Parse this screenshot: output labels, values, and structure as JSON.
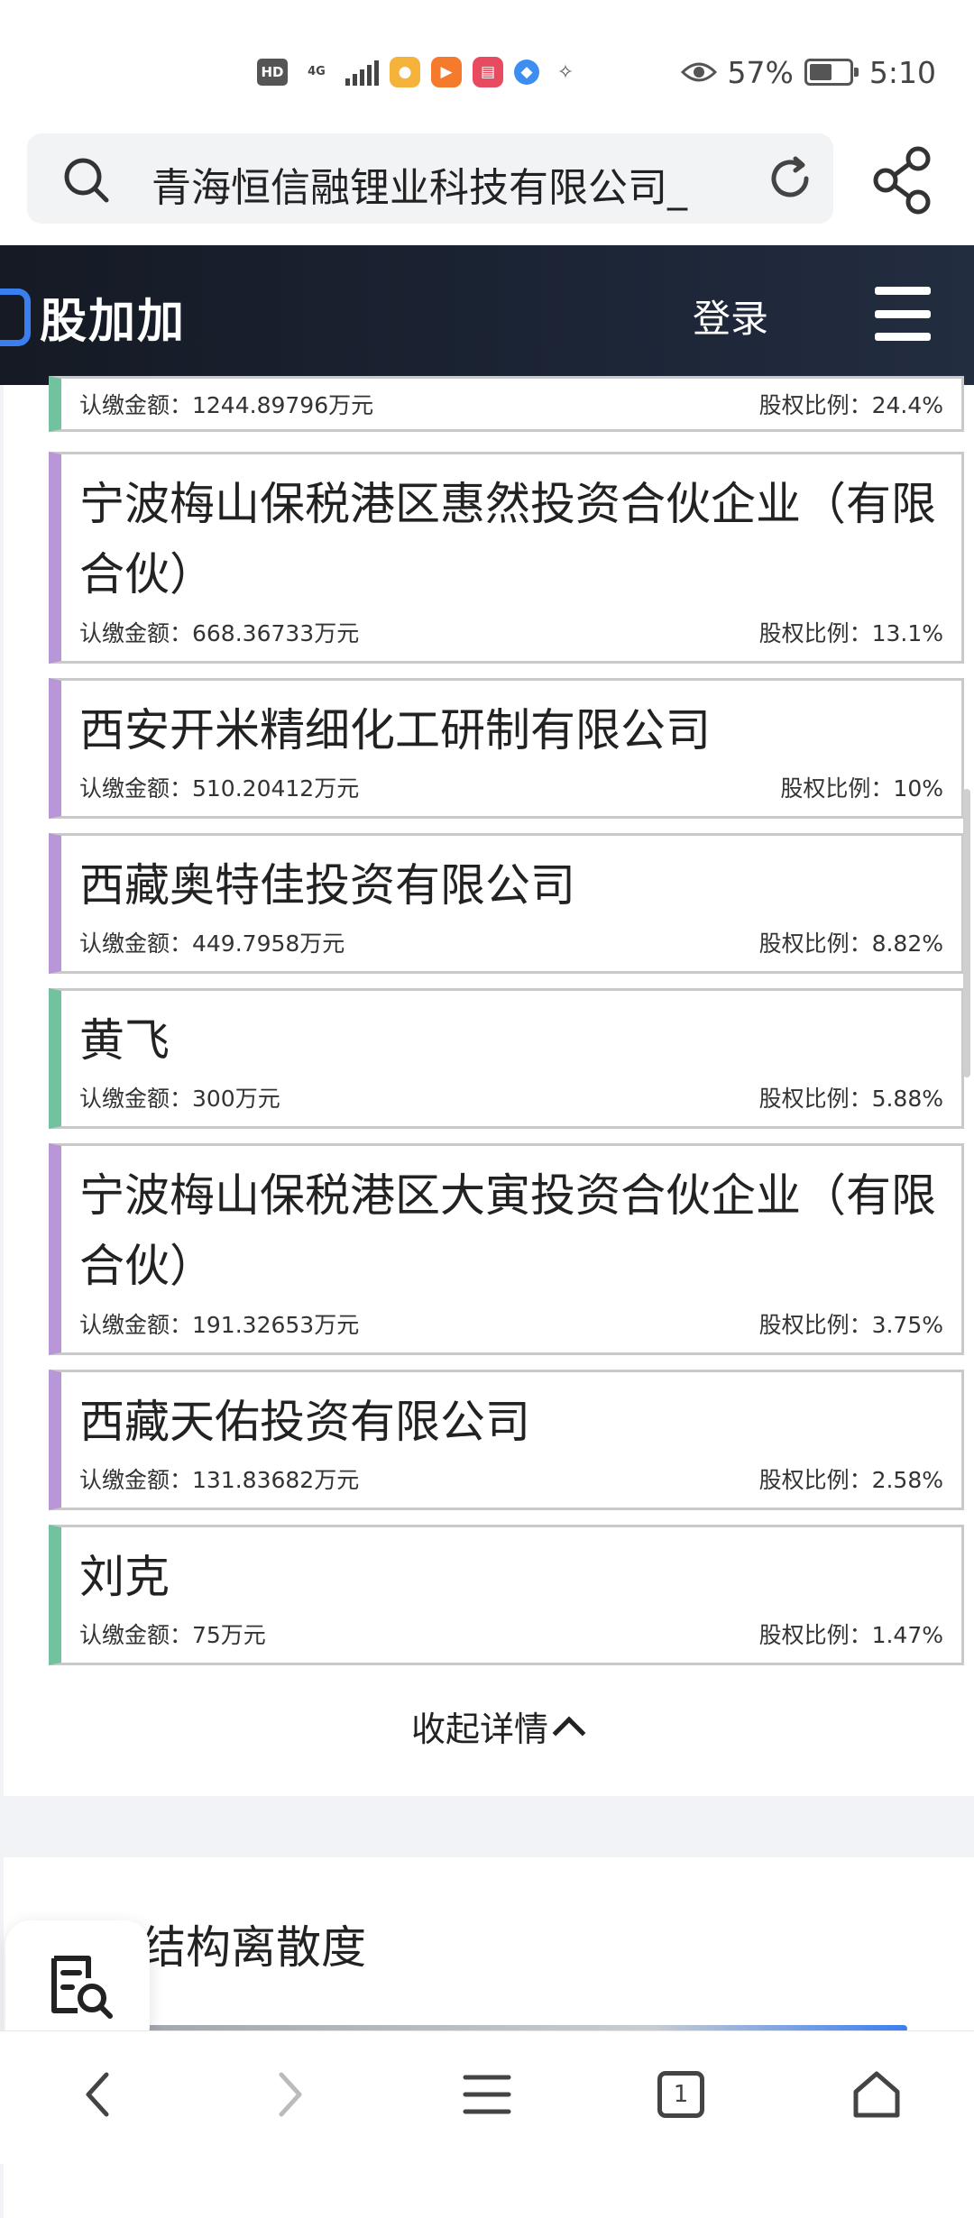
{
  "status_bar": {
    "hd_label": "HD",
    "network_label": "4G",
    "battery_percent": "57%",
    "battery_level": 0.57,
    "time": "5:10"
  },
  "browser": {
    "address_text": "青海恒信融锂业科技有限公司_"
  },
  "site": {
    "logo_text": "股加加",
    "login_label": "登录"
  },
  "shareholders": [
    {
      "name": "",
      "amount": "认缴金额：1244.89796万元",
      "ratio": "股权比例：24.4%",
      "color": "green"
    },
    {
      "name": "宁波梅山保税港区惠然投资合伙企业（有限合伙）",
      "amount": "认缴金额：668.36733万元",
      "ratio": "股权比例：13.1%",
      "color": "purple"
    },
    {
      "name": "西安开米精细化工研制有限公司",
      "amount": "认缴金额：510.20412万元",
      "ratio": "股权比例：10%",
      "color": "purple"
    },
    {
      "name": "西藏奥特佳投资有限公司",
      "amount": "认缴金额：449.7958万元",
      "ratio": "股权比例：8.82%",
      "color": "purple"
    },
    {
      "name": "黄飞",
      "amount": "认缴金额：300万元",
      "ratio": "股权比例：5.88%",
      "color": "green"
    },
    {
      "name": "宁波梅山保税港区大寅投资合伙企业（有限合伙）",
      "amount": "认缴金额：191.32653万元",
      "ratio": "股权比例：3.75%",
      "color": "purple"
    },
    {
      "name": "西藏天佑投资有限公司",
      "amount": "认缴金额：131.83682万元",
      "ratio": "股权比例：2.58%",
      "color": "purple"
    },
    {
      "name": "刘克",
      "amount": "认缴金额：75万元",
      "ratio": "股权比例：1.47%",
      "color": "green"
    }
  ],
  "collapse_label": "收起详情",
  "next_section": {
    "title": "股权结构离散度"
  },
  "bottom_nav": {
    "tab_count": "1"
  },
  "colors": {
    "purple_accent": "#b996d8",
    "green_accent": "#72c2a0",
    "header_bg": "#1c2536",
    "logo_blue": "#3a7ff0"
  }
}
